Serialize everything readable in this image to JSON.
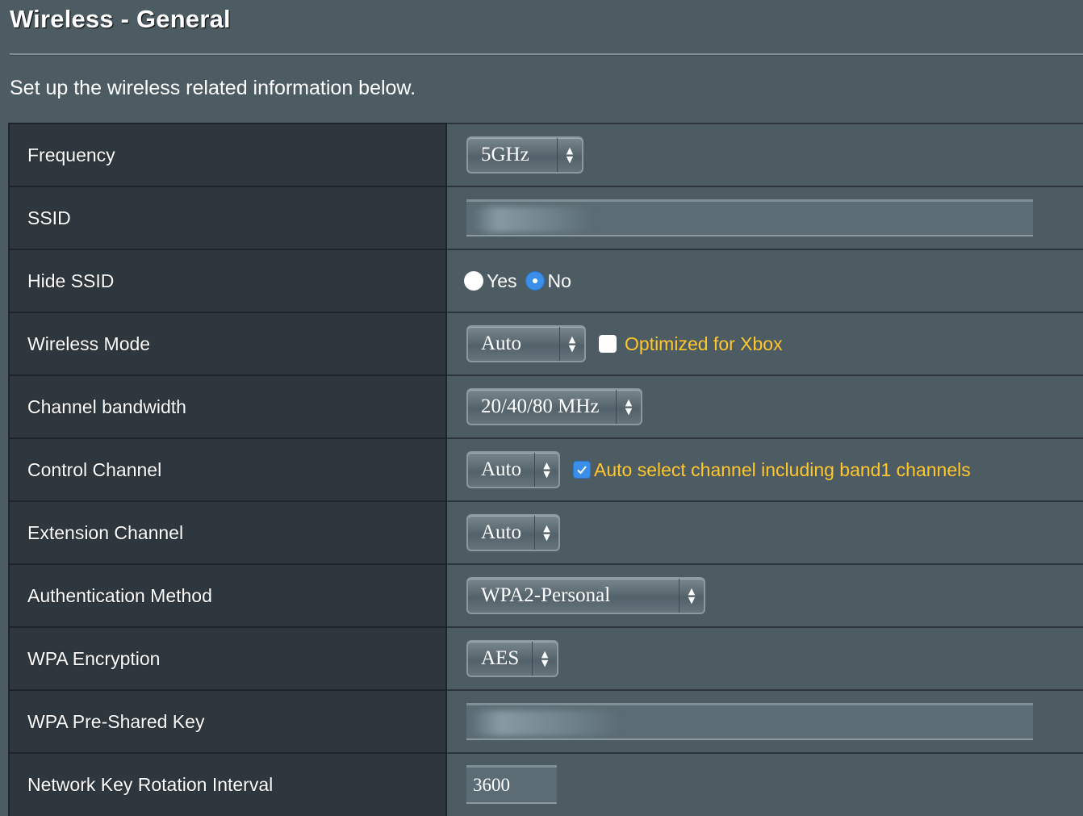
{
  "header": {
    "title": "Wireless - General",
    "description": "Set up the wireless related information below."
  },
  "colors": {
    "background": "#4d5b62",
    "label_column": "#2e373d",
    "highlight_text": "#ffc72c",
    "accent_blue": "#3b8fe8"
  },
  "fields": {
    "frequency": {
      "label": "Frequency",
      "value": "5GHz"
    },
    "ssid": {
      "label": "SSID",
      "value": ""
    },
    "hide_ssid": {
      "label": "Hide SSID",
      "yes_label": "Yes",
      "no_label": "No",
      "selected": "No"
    },
    "wireless_mode": {
      "label": "Wireless Mode",
      "value": "Auto",
      "xbox_label": "Optimized for Xbox",
      "xbox_checked": false
    },
    "channel_bandwidth": {
      "label": "Channel bandwidth",
      "value": "20/40/80 MHz"
    },
    "control_channel": {
      "label": "Control Channel",
      "value": "Auto",
      "band1_label": "Auto select channel including band1 channels",
      "band1_checked": true
    },
    "extension_channel": {
      "label": "Extension Channel",
      "value": "Auto"
    },
    "auth_method": {
      "label": "Authentication Method",
      "value": "WPA2-Personal"
    },
    "wpa_encryption": {
      "label": "WPA Encryption",
      "value": "AES"
    },
    "wpa_psk": {
      "label": "WPA Pre-Shared Key",
      "value": ""
    },
    "key_rotation": {
      "label": "Network Key Rotation Interval",
      "value": "3600"
    }
  }
}
